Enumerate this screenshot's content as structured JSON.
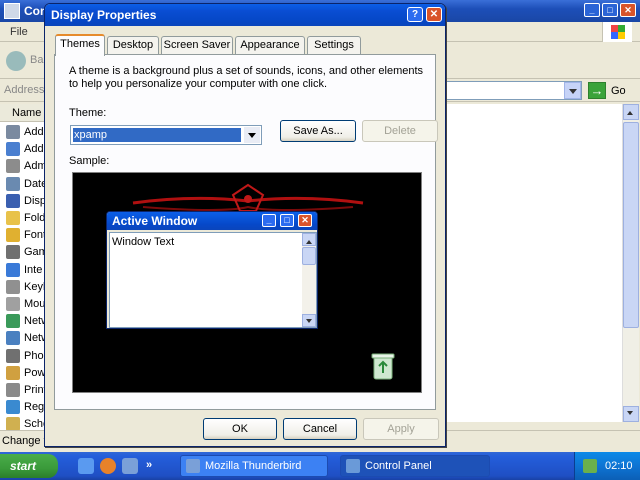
{
  "background_window": {
    "title": "Con",
    "menu_file": "File",
    "back_label": "Ba",
    "address_label": "Address",
    "go_label": "Go",
    "list_header": "Name",
    "items": [
      {
        "label": "Add",
        "icon": "add-hardware-icon",
        "color": "#7a8aa0"
      },
      {
        "label": "Add",
        "icon": "add-remove-programs-icon",
        "color": "#4a7fd0"
      },
      {
        "label": "Adm",
        "icon": "administrative-tools-icon",
        "color": "#8c8c8c"
      },
      {
        "label": "Date",
        "icon": "date-time-icon",
        "color": "#6a8ab0"
      },
      {
        "label": "Disp",
        "icon": "display-icon",
        "color": "#3a5fb0"
      },
      {
        "label": "Fold",
        "icon": "folder-options-icon",
        "color": "#e8c24a"
      },
      {
        "label": "Font",
        "icon": "fonts-icon",
        "color": "#e0b030"
      },
      {
        "label": "Gam",
        "icon": "game-controllers-icon",
        "color": "#707070"
      },
      {
        "label": "Inte",
        "icon": "internet-options-icon",
        "color": "#3a7ad8"
      },
      {
        "label": "Keyb",
        "icon": "keyboard-icon",
        "color": "#909090"
      },
      {
        "label": "Mou",
        "icon": "mouse-icon",
        "color": "#a0a0a0"
      },
      {
        "label": "Netw",
        "icon": "network-setup-icon",
        "color": "#3a9a5a"
      },
      {
        "label": "Netw",
        "icon": "network-connections-icon",
        "color": "#4a80c0"
      },
      {
        "label": "Phon",
        "icon": "phone-modem-icon",
        "color": "#707070"
      },
      {
        "label": "Pow",
        "icon": "power-options-icon",
        "color": "#d0a040"
      },
      {
        "label": "Print",
        "icon": "printers-faxes-icon",
        "color": "#8a8a8a"
      },
      {
        "label": "Regi",
        "icon": "regional-options-icon",
        "color": "#3a8ad0"
      },
      {
        "label": "Sche",
        "icon": "scheduled-tasks-icon",
        "color": "#d0b050"
      }
    ],
    "status_text": "Change t"
  },
  "dialog": {
    "title": "Display Properties",
    "help_glyph": "?",
    "close_glyph": "✕",
    "tabs": [
      {
        "label": "Themes",
        "active": true
      },
      {
        "label": "Desktop",
        "active": false
      },
      {
        "label": "Screen Saver",
        "active": false
      },
      {
        "label": "Appearance",
        "active": false
      },
      {
        "label": "Settings",
        "active": false
      }
    ],
    "description": "A theme is a background plus a set of sounds, icons, and other elements to help you personalize your computer with one click.",
    "theme_label": "Theme:",
    "theme_value": "xpamp",
    "save_as_label": "Save As...",
    "delete_label": "Delete",
    "sample_label": "Sample:",
    "preview": {
      "window_title": "Active Window",
      "window_text": "Window Text"
    },
    "ok_label": "OK",
    "cancel_label": "Cancel",
    "apply_label": "Apply"
  },
  "taskbar": {
    "start_label": "start",
    "quick_launch_more": "»",
    "tasks": [
      {
        "label": "Mozilla Thunderbird",
        "active": false,
        "icon": "thunderbird-icon",
        "color": "#7aa0d8"
      },
      {
        "label": "Control Panel",
        "active": true,
        "icon": "control-panel-icon",
        "color": "#6a9ad8"
      }
    ],
    "clock": "02:10"
  },
  "colors": {
    "title_blue": "#0648c8",
    "selection_blue": "#316ac5",
    "preview_bg": "#000000",
    "preview_accent": "#b01010",
    "start_green": "#3a9a3a"
  }
}
